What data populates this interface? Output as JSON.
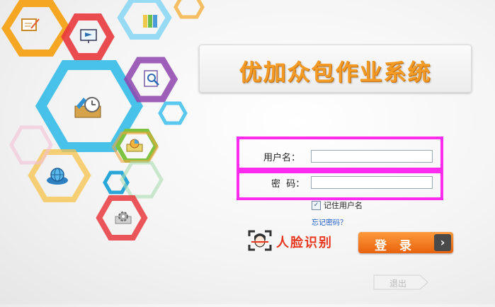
{
  "app": {
    "title": "优加众包作业系统"
  },
  "form": {
    "username_label": "用户名：",
    "username_value": "",
    "password_label": "密  码：",
    "password_value": "",
    "remember_label": "记住用户名",
    "remember_checked": true,
    "forgot_link": "忘记密码？"
  },
  "buttons": {
    "face_recognition": "人脸识别",
    "login": "登 录",
    "exit": "退出"
  },
  "colors": {
    "highlight_box": "#ff2cf0",
    "title_orange": "#f39b25",
    "login_orange": "#e8620c",
    "face_red": "#e8371f"
  },
  "icons": [
    "notepad-icon",
    "presentation-icon",
    "binders-icon",
    "search-document-icon",
    "clock-chart-icon",
    "pie-chart-icon",
    "globe-disk-icon",
    "gear-icon",
    "face-scan-icon"
  ]
}
